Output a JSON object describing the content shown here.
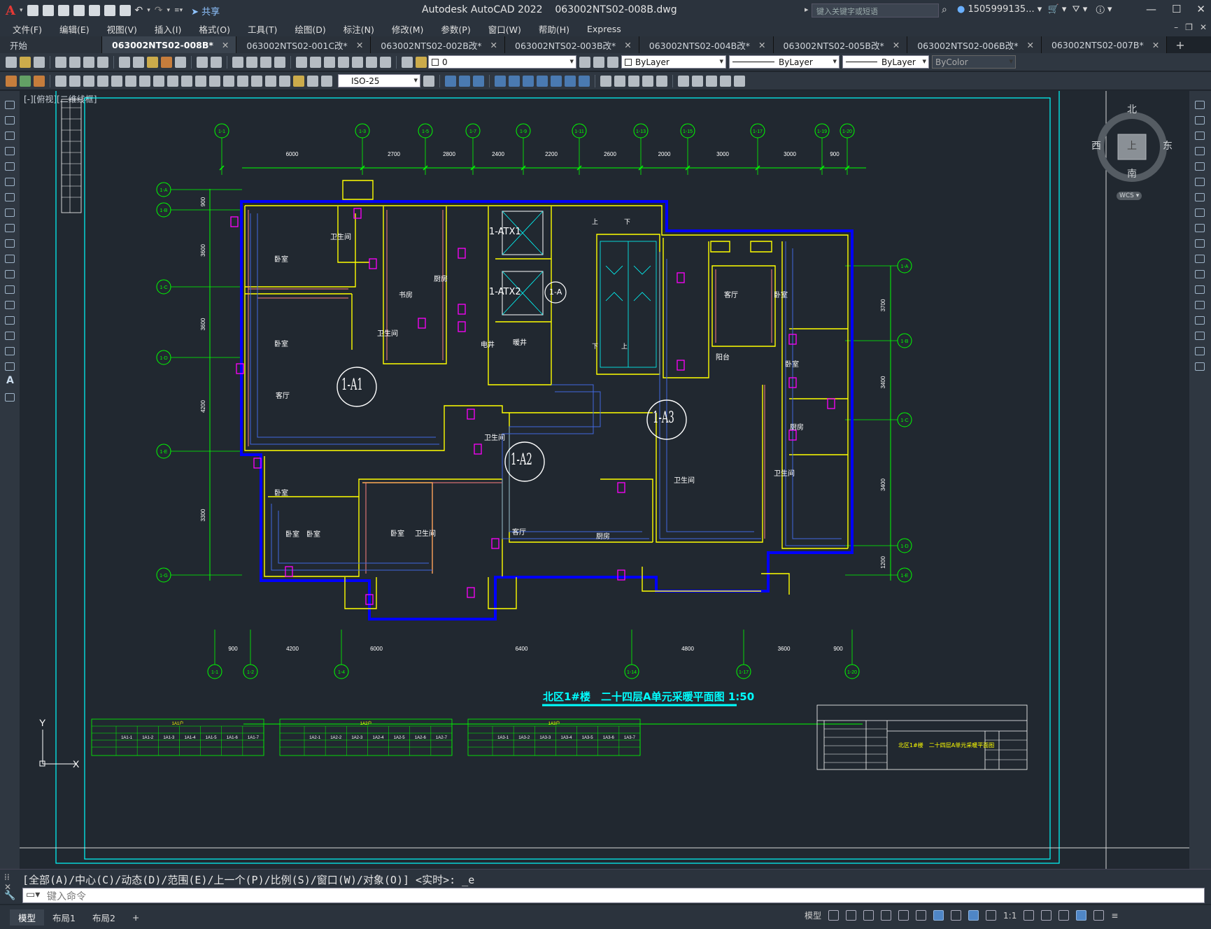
{
  "app": {
    "title": "Autodesk AutoCAD 2022",
    "file": "063002NTS02-008B.dwg",
    "share": "共享",
    "search_placeholder": "键入关键字或短语",
    "user": "1505999135...",
    "logo": "A"
  },
  "menu": [
    "文件(F)",
    "编辑(E)",
    "视图(V)",
    "插入(I)",
    "格式(O)",
    "工具(T)",
    "绘图(D)",
    "标注(N)",
    "修改(M)",
    "参数(P)",
    "窗口(W)",
    "帮助(H)",
    "Express"
  ],
  "tabs": [
    {
      "label": "开始",
      "active": false
    },
    {
      "label": "063002NTS02-008B*",
      "active": true
    },
    {
      "label": "063002NTS02-001C改*",
      "active": false
    },
    {
      "label": "063002NTS02-002B改*",
      "active": false
    },
    {
      "label": "063002NTS02-003B改*",
      "active": false
    },
    {
      "label": "063002NTS02-004B改*",
      "active": false
    },
    {
      "label": "063002NTS02-005B改*",
      "active": false
    },
    {
      "label": "063002NTS02-006B改*",
      "active": false
    },
    {
      "label": "063002NTS02-007B*",
      "active": false
    }
  ],
  "toolbar": {
    "layer": "0",
    "color": "ByLayer",
    "linetype": "ByLayer",
    "lineweight": "ByLayer",
    "plotstyle": "ByColor",
    "dimstyle": "ISO-25"
  },
  "viewport_label": "[-][俯视][二维线框]",
  "navcube": {
    "north": "北",
    "south": "南",
    "east": "东",
    "west": "西",
    "top": "上",
    "wcs": "WCS"
  },
  "drawing": {
    "title": "北区1#楼　二十四层A单元采暖平面图 1:50",
    "top_axes": [
      "1-1",
      "1-3",
      "1-5",
      "1-7",
      "1-9",
      "1-11",
      "1-13",
      "1-15",
      "1-17",
      "1-19",
      "1-20"
    ],
    "top_dims": [
      "6000",
      "2700",
      "2800",
      "2400",
      "2200",
      "2600",
      "2000",
      "3000",
      "3000",
      "900"
    ],
    "bottom_axes": [
      "1-1",
      "1-2",
      "1-4",
      "1-14",
      "1-17",
      "1-20"
    ],
    "bottom_dims": [
      "900",
      "4200",
      "6000",
      "6400",
      "4800",
      "3600",
      "900"
    ],
    "left_axes": [
      "1-A",
      "1-B",
      "1-C",
      "1-D",
      "1-E",
      "1-G"
    ],
    "left_dims": [
      "900",
      "3600",
      "3600",
      "4200",
      "3300"
    ],
    "right_axes": [
      "1-A",
      "1-B",
      "1-C",
      "1-D",
      "1-E",
      "1-G"
    ],
    "right_dims": [
      "3700",
      "3400",
      "3400",
      "1200"
    ],
    "zones": [
      "1-A1",
      "1-A2",
      "1-A3"
    ],
    "shafts": [
      "1-ATX1",
      "1-ATX2",
      "1-A"
    ],
    "rooms": [
      "卧室",
      "卧室",
      "卫生间",
      "书房",
      "厨房",
      "卫生间",
      "客厅",
      "卫生间",
      "卧室",
      "卧室",
      "卧室",
      "卫生间",
      "客厅",
      "厨房",
      "电井",
      "暖井",
      "客厅",
      "卧室",
      "卧室",
      "厨房",
      "卫生间",
      "卫生间",
      "卧室",
      "阳台"
    ],
    "stairs": [
      "上",
      "下",
      "下",
      "上"
    ],
    "tables": [
      {
        "caption": "1A1户",
        "cols": [
          "1A1-1",
          "1A1-2",
          "1A1-3",
          "1A1-4",
          "1A1-5",
          "1A1-6",
          "1A1-7"
        ]
      },
      {
        "caption": "1A2户",
        "cols": [
          "1A2-1",
          "1A2-2",
          "1A2-3",
          "1A2-4",
          "1A2-5",
          "1A2-6",
          "1A2-7"
        ]
      },
      {
        "caption": "1A3户",
        "cols": [
          "1A3-1",
          "1A3-2",
          "1A3-3",
          "1A3-4",
          "1A3-5",
          "1A3-6",
          "1A3-7"
        ]
      }
    ],
    "titleblock_name": "北区1#楼　二十四层A单元采暖平面图"
  },
  "command": {
    "history": "[全部(A)/中心(C)/动态(D)/范围(E)/上一个(P)/比例(S)/窗口(W)/对象(O)] <实时>: _e",
    "placeholder": "键入命令"
  },
  "status": {
    "layouts": [
      "模型",
      "布局1",
      "布局2"
    ],
    "model": "模型",
    "scale": "1:1"
  },
  "colors": {
    "accent": "#00ffff",
    "wall": "#ffff00",
    "heating": "#0000ff",
    "axis": "#00ff00",
    "riser": "#ff00ff"
  }
}
